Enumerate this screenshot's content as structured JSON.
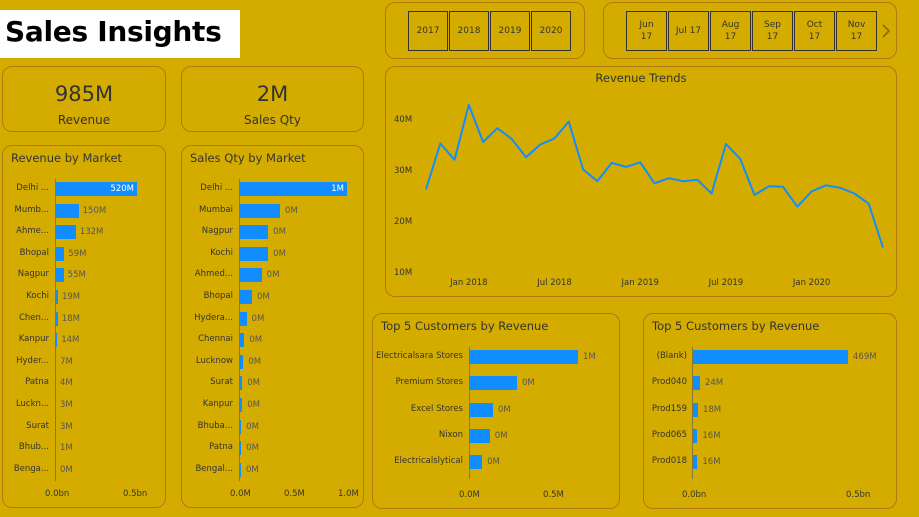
{
  "title": "Sales Insights",
  "kpis": {
    "revenue": {
      "value": "985M",
      "label": "Revenue"
    },
    "qty": {
      "value": "2M",
      "label": "Sales Qty"
    }
  },
  "year_slicer": [
    "2017",
    "2018",
    "2019",
    "2020"
  ],
  "month_slicer": [
    {
      "m": "Jun",
      "y": "17"
    },
    {
      "m": "Jul 17",
      "y": ""
    },
    {
      "m": "Aug",
      "y": "17"
    },
    {
      "m": "Sep",
      "y": "17"
    },
    {
      "m": "Oct",
      "y": "17"
    },
    {
      "m": "Nov",
      "y": "17"
    }
  ],
  "month_slicer_next_icon": "chevron-right-icon",
  "chart_data": [
    {
      "type": "bar",
      "title": "Revenue by Market",
      "categories": [
        "Delhi ...",
        "Mumb...",
        "Ahme...",
        "Bhopal",
        "Nagpur",
        "Kochi",
        "Chen...",
        "Kanpur",
        "Hyder...",
        "Patna",
        "Luckn...",
        "Surat",
        "Bhub...",
        "Benga..."
      ],
      "values": [
        520,
        150,
        132,
        59,
        55,
        19,
        18,
        14,
        7,
        4,
        3,
        3,
        1,
        0
      ],
      "labels": [
        "520M",
        "150M",
        "132M",
        "59M",
        "55M",
        "19M",
        "18M",
        "14M",
        "7M",
        "4M",
        "3M",
        "3M",
        "1M",
        "0M"
      ],
      "xlim": [
        0,
        520
      ],
      "xticks": [
        "0.0bn",
        "0.5bn"
      ]
    },
    {
      "type": "bar",
      "title": "Sales Qty by Market",
      "categories": [
        "Delhi ...",
        "Mumbai",
        "Nagpur",
        "Kochi",
        "Ahmed...",
        "Bhopal",
        "Hydera...",
        "Chennai",
        "Lucknow",
        "Surat",
        "Kanpur",
        "Bhuba...",
        "Patna",
        "Bengal..."
      ],
      "values": [
        1.0,
        0.38,
        0.27,
        0.27,
        0.21,
        0.12,
        0.07,
        0.05,
        0.04,
        0.03,
        0.03,
        0.02,
        0.02,
        0.01
      ],
      "labels": [
        "1M",
        "0M",
        "0M",
        "0M",
        "0M",
        "0M",
        "0M",
        "0M",
        "0M",
        "0M",
        "0M",
        "0M",
        "0M",
        "0M"
      ],
      "xlim": [
        0,
        1.0
      ],
      "xticks": [
        "0.0M",
        "0.5M",
        "1.0M"
      ]
    },
    {
      "type": "line",
      "title": "Revenue Trends",
      "x": [
        "2017-10",
        "2017-11",
        "2017-12",
        "2018-01",
        "2018-02",
        "2018-03",
        "2018-04",
        "2018-05",
        "2018-06",
        "2018-07",
        "2018-08",
        "2018-09",
        "2018-10",
        "2018-11",
        "2018-12",
        "2019-01",
        "2019-02",
        "2019-03",
        "2019-04",
        "2019-05",
        "2019-06",
        "2019-07",
        "2019-08",
        "2019-09",
        "2019-10",
        "2019-11",
        "2019-12",
        "2020-01",
        "2020-02",
        "2020-03",
        "2020-04",
        "2020-05",
        "2020-06"
      ],
      "values": [
        26.2,
        35.2,
        32.0,
        42.8,
        35.5,
        38.2,
        36.1,
        32.5,
        35.0,
        36.2,
        39.5,
        30.1,
        27.8,
        31.4,
        30.6,
        31.5,
        27.4,
        28.4,
        27.8,
        28.1,
        25.4,
        35.1,
        32.2,
        25.1,
        26.8,
        26.7,
        22.8,
        25.8,
        27.0,
        26.5,
        25.4,
        23.4,
        14.8
      ],
      "xticks": [
        "Jan 2018",
        "Jul 2018",
        "Jan 2019",
        "Jul 2019",
        "Jan 2020"
      ],
      "yticks": [
        "40M",
        "30M",
        "20M",
        "10M"
      ],
      "ylim": [
        10,
        40
      ]
    },
    {
      "type": "bar",
      "title": "Top 5 Customers by Revenue",
      "categories": [
        "Electricalsara Stores",
        "Premium Stores",
        "Excel Stores",
        "Nixon",
        "Electricalslytical"
      ],
      "values": [
        1.0,
        0.44,
        0.22,
        0.19,
        0.12
      ],
      "labels": [
        "1M",
        "0M",
        "0M",
        "0M",
        "0M"
      ],
      "xlim": [
        0,
        1.0
      ],
      "xticks": [
        "0.0M",
        "0.5M"
      ]
    },
    {
      "type": "bar",
      "title": "Top 5 Customers by Revenue",
      "categories": [
        "(Blank)",
        "Prod040",
        "Prod159",
        "Prod065",
        "Prod018"
      ],
      "values": [
        469,
        24,
        18,
        16,
        16
      ],
      "labels": [
        "469M",
        "24M",
        "18M",
        "16M",
        "16M"
      ],
      "xlim": [
        0,
        469
      ],
      "xticks": [
        "0.0bn",
        "0.5bn"
      ]
    }
  ],
  "colors": {
    "background": "#d4ac00",
    "bar": "#118dff",
    "border": "#b07a10"
  }
}
